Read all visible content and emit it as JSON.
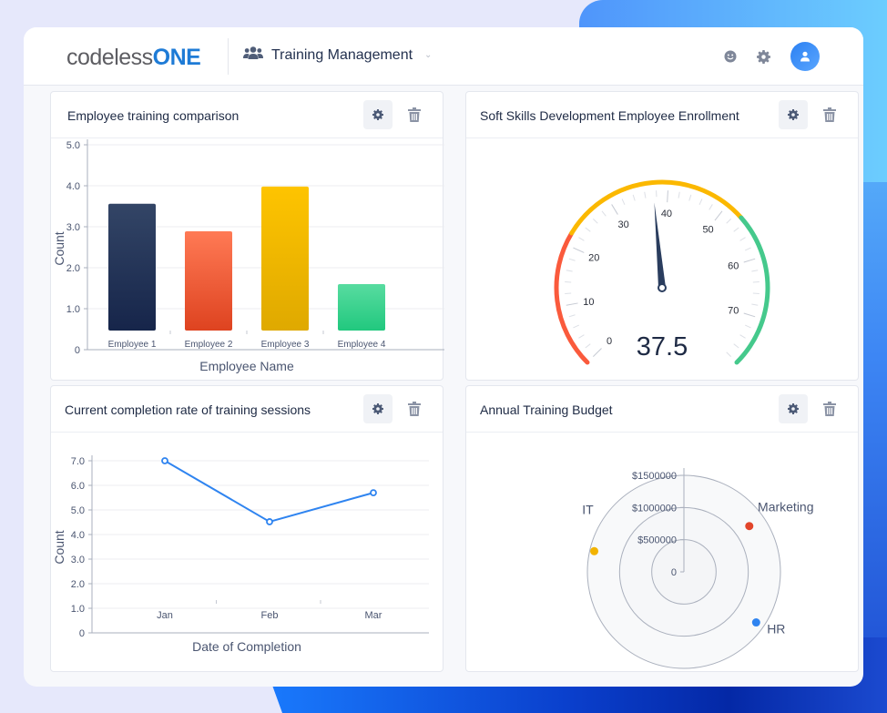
{
  "header": {
    "logo_part1": "codeless",
    "logo_part2": "ONE",
    "app_name": "Training Management",
    "app_icon": "users-icon",
    "icons": [
      "smiley-icon",
      "gear-icon",
      "user-avatar-icon"
    ]
  },
  "colors": {
    "brand_blue": "#1e7bd6",
    "accent_blue": "#2b80f2",
    "text_dark": "#1e2a44"
  },
  "widgets": [
    {
      "title": "Employee training comparison",
      "actions": [
        "settings",
        "delete"
      ]
    },
    {
      "title": "Soft Skills Development Employee Enrollment",
      "actions": [
        "settings",
        "delete"
      ]
    },
    {
      "title": "Current completion rate of training sessions",
      "actions": [
        "settings",
        "delete"
      ]
    },
    {
      "title": "Annual Training Budget",
      "actions": [
        "settings",
        "delete"
      ]
    }
  ],
  "chart_data": [
    {
      "type": "bar",
      "title": "Employee training comparison",
      "categories": [
        "Employee 1",
        "Employee 2",
        "Employee 3",
        "Employee 4"
      ],
      "values": [
        3.56,
        2.89,
        3.98,
        1.6
      ],
      "colors": [
        [
          "#334566",
          "#16254a"
        ],
        [
          "#ff7a55",
          "#de4320"
        ],
        [
          "#fec400",
          "#dfa900"
        ],
        [
          "#58dca0",
          "#21c87e"
        ]
      ],
      "xlabel": "Employee Name",
      "ylabel": "Count",
      "ylim": [
        0,
        5
      ],
      "yticks": [
        "0",
        "1.0",
        "2.0",
        "3.0",
        "4.0",
        "5.0"
      ],
      "grid": true
    },
    {
      "type": "gauge",
      "title": "Soft Skills Development Employee Enrollment",
      "value": 37.5,
      "value_label": "37.5",
      "range": [
        0,
        78
      ],
      "tick_labels": [
        "0",
        "10",
        "20",
        "30",
        "40",
        "50",
        "60",
        "70"
      ],
      "bands": [
        {
          "from": 0,
          "to": 22,
          "color": "#fa5a3c"
        },
        {
          "from": 22,
          "to": 53,
          "color": "#fbb800"
        },
        {
          "from": 53,
          "to": 78,
          "color": "#45c98c"
        }
      ],
      "needle_color": "#2a3d5e"
    },
    {
      "type": "line",
      "title": "Current completion rate of training sessions",
      "categories": [
        "Jan",
        "Feb",
        "Mar"
      ],
      "series": [
        {
          "name": "Count",
          "values": [
            7.0,
            4.52,
            5.7
          ],
          "color": "#2f84f0"
        }
      ],
      "xlabel": "Date of Completion",
      "ylabel": "Count",
      "ylim": [
        0,
        7
      ],
      "yticks": [
        "0",
        "1.0",
        "2.0",
        "3.0",
        "4.0",
        "5.0",
        "6.0",
        "7.0"
      ],
      "grid": true
    },
    {
      "type": "polar-scatter",
      "title": "Annual Training Budget",
      "points": [
        {
          "name": "Marketing",
          "value": 1240000,
          "color": "#e2452a"
        },
        {
          "name": "HR",
          "value": 1370000,
          "color": "#2f84f0"
        },
        {
          "name": "IT",
          "value": 1430000,
          "color": "#f2b300"
        }
      ],
      "rlim": [
        0,
        1500000
      ],
      "rticks": [
        "0",
        "$500000",
        "$1000000",
        "$1500000"
      ]
    }
  ]
}
